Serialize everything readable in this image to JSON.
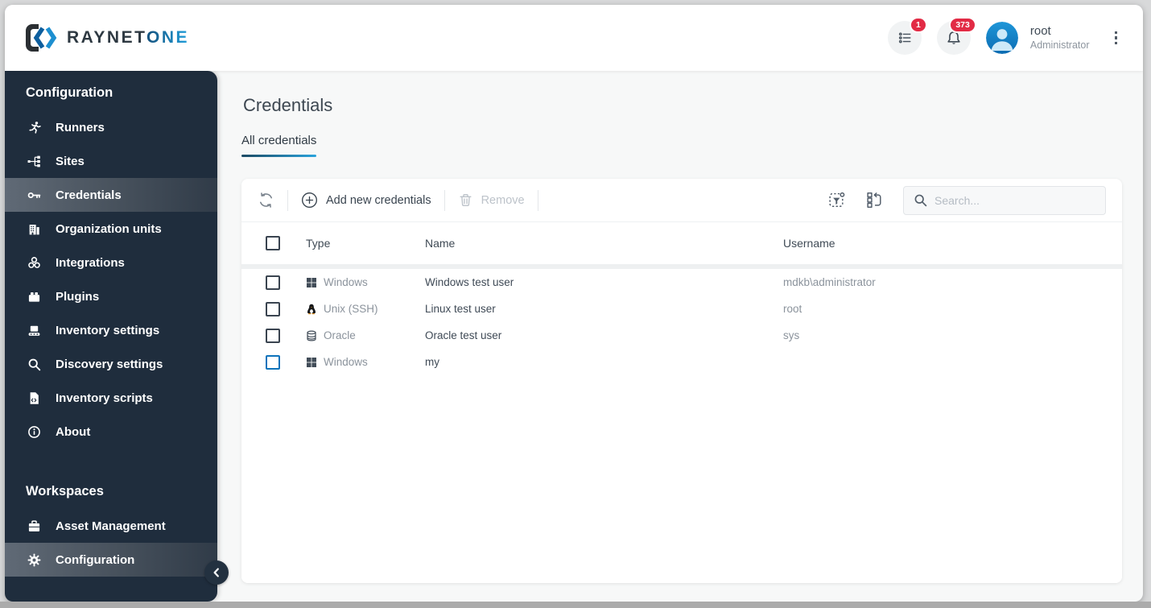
{
  "brand": {
    "name_primary": "RAYNET",
    "name_secondary": "ONE"
  },
  "topbar": {
    "queue_badge": "1",
    "notifications_badge": "373",
    "user": {
      "name": "root",
      "role": "Administrator"
    }
  },
  "sidebar": {
    "sections": [
      {
        "label": "Configuration",
        "items": [
          {
            "label": "Runners",
            "icon": "runner-icon",
            "selected": false
          },
          {
            "label": "Sites",
            "icon": "sites-icon",
            "selected": false
          },
          {
            "label": "Credentials",
            "icon": "key-icon",
            "selected": true
          },
          {
            "label": "Organization units",
            "icon": "building-icon",
            "selected": false
          },
          {
            "label": "Integrations",
            "icon": "integrations-icon",
            "selected": false
          },
          {
            "label": "Plugins",
            "icon": "plugin-icon",
            "selected": false
          },
          {
            "label": "Inventory settings",
            "icon": "conveyor-icon",
            "selected": false
          },
          {
            "label": "Discovery settings",
            "icon": "magnifier-icon",
            "selected": false
          },
          {
            "label": "Inventory scripts",
            "icon": "script-icon",
            "selected": false
          },
          {
            "label": "About",
            "icon": "info-icon",
            "selected": false
          }
        ]
      },
      {
        "label": "Workspaces",
        "items": [
          {
            "label": "Asset Management",
            "icon": "briefcase-icon",
            "selected": false
          },
          {
            "label": "Configuration",
            "icon": "gear-icon",
            "selected": true
          }
        ]
      }
    ]
  },
  "page": {
    "title": "Credentials",
    "tabs": [
      {
        "label": "All credentials",
        "active": true
      }
    ]
  },
  "toolbar": {
    "add_label": "Add new credentials",
    "remove_label": "Remove",
    "search_placeholder": "Search..."
  },
  "table": {
    "columns": [
      "Type",
      "Name",
      "Username"
    ],
    "rows": [
      {
        "type": "Windows",
        "type_icon": "windows-icon",
        "name": "Windows test user",
        "username": "mdkb\\administrator",
        "checkbox_focused": false
      },
      {
        "type": "Unix (SSH)",
        "type_icon": "linux-icon",
        "name": "Linux test user",
        "username": "root",
        "checkbox_focused": false
      },
      {
        "type": "Oracle",
        "type_icon": "database-icon",
        "name": "Oracle test user",
        "username": "sys",
        "checkbox_focused": false
      },
      {
        "type": "Windows",
        "type_icon": "windows-icon",
        "name": "my",
        "username": "",
        "checkbox_focused": true
      }
    ]
  },
  "colors": {
    "sidebar_bg": "#1f2d3d",
    "accent_blue": "#21a0dd",
    "badge_red": "#e22b45",
    "checkbox_focus_blue": "#0e73bb"
  }
}
